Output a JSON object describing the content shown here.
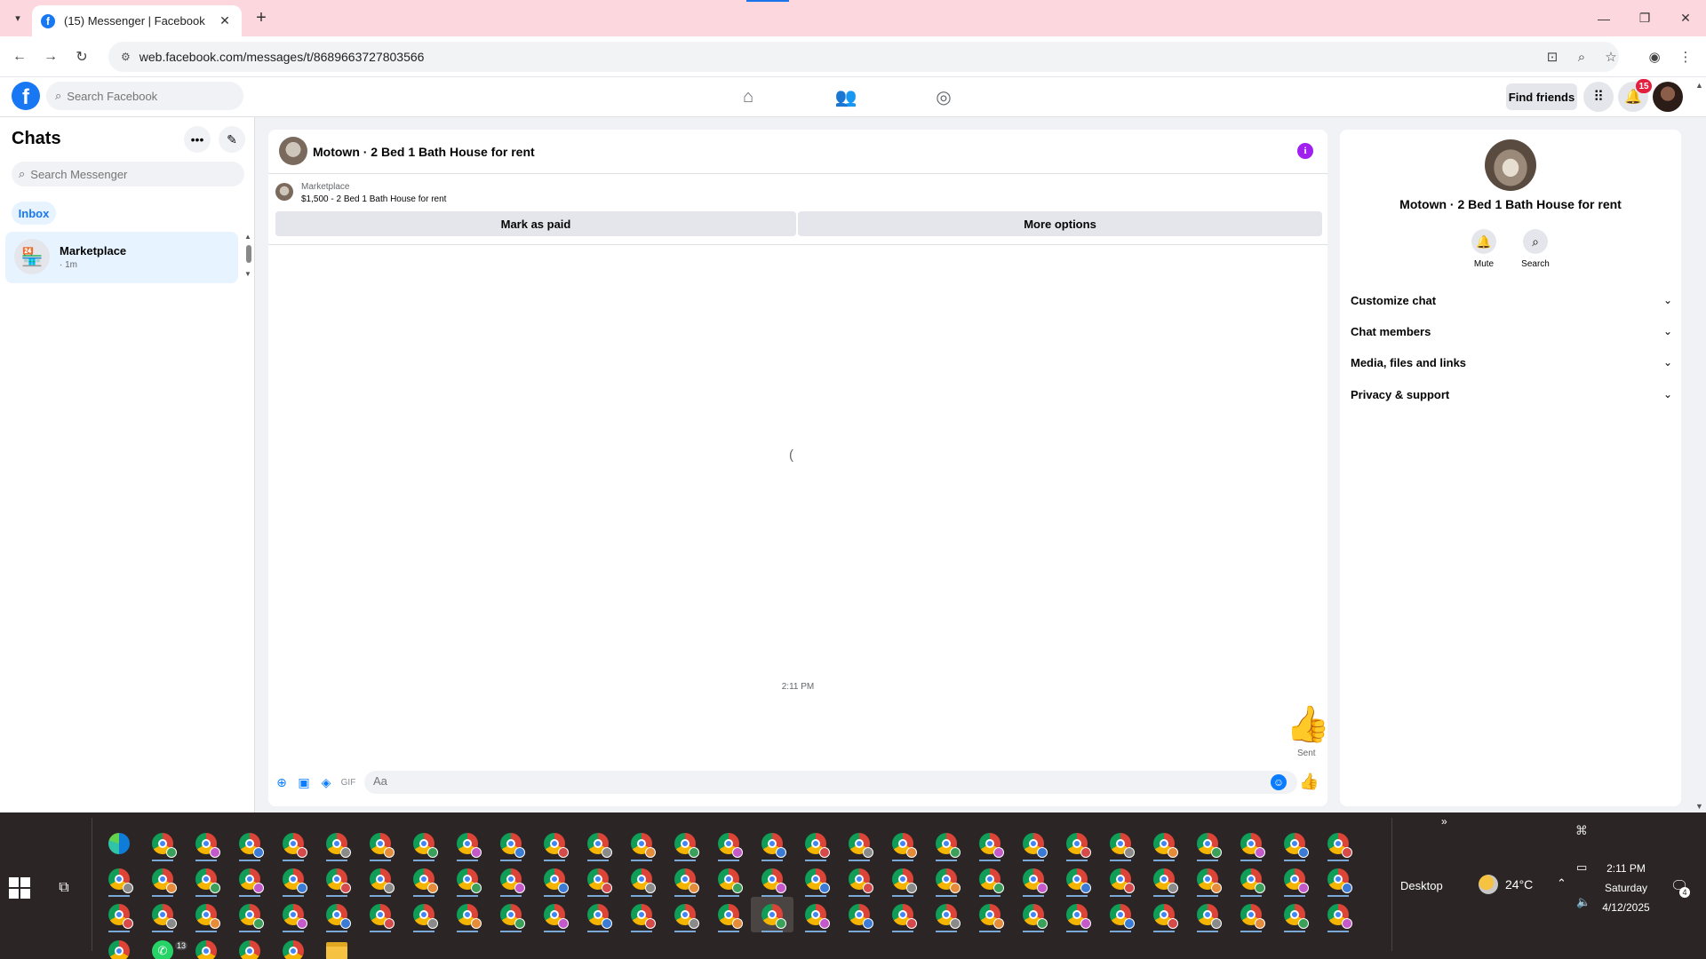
{
  "browser": {
    "tab_title": "(15) Messenger | Facebook",
    "url": "web.facebook.com/messages/t/8689663727803566",
    "new_tab_label": "+"
  },
  "fb_header": {
    "search_placeholder": "Search Facebook",
    "find_friends_label": "Find friends",
    "notification_count": "15"
  },
  "left_panel": {
    "title": "Chats",
    "search_placeholder": "Search Messenger",
    "filter_label": "Inbox",
    "chats": [
      {
        "name": "Marketplace",
        "time": "· 1m"
      }
    ]
  },
  "conversation": {
    "title": "Motown · 2 Bed 1 Bath House for rent",
    "banner_label": "Marketplace",
    "banner_desc": "$1,500 - 2 Bed 1 Bath House for rent",
    "mark_paid_label": "Mark as paid",
    "more_options_label": "More options",
    "loading_glyph": "(",
    "timestamp": "2:11 PM",
    "sent_label": "Sent",
    "composer_placeholder": "Aa"
  },
  "info_panel": {
    "name": "Motown · 2 Bed 1 Bath House for rent",
    "actions": [
      {
        "label": "Mute",
        "icon": "bell-icon"
      },
      {
        "label": "Search",
        "icon": "search-icon"
      }
    ],
    "sections": [
      {
        "label": "Customize chat"
      },
      {
        "label": "Chat members"
      },
      {
        "label": "Media, files and links"
      },
      {
        "label": "Privacy & support"
      }
    ]
  },
  "taskbar": {
    "desktop_label": "Desktop",
    "temperature": "24°C",
    "time": "2:11 PM",
    "day": "Saturday",
    "date": "4/12/2025",
    "whatsapp_badge": "13",
    "notification_count": "4"
  },
  "colors": {
    "accent": "#1877f2",
    "messenger_blue": "#0a7cff",
    "tab_bar": "#fcd7dd",
    "taskbar": "#2b2625",
    "info_purple": "#a020f0"
  }
}
